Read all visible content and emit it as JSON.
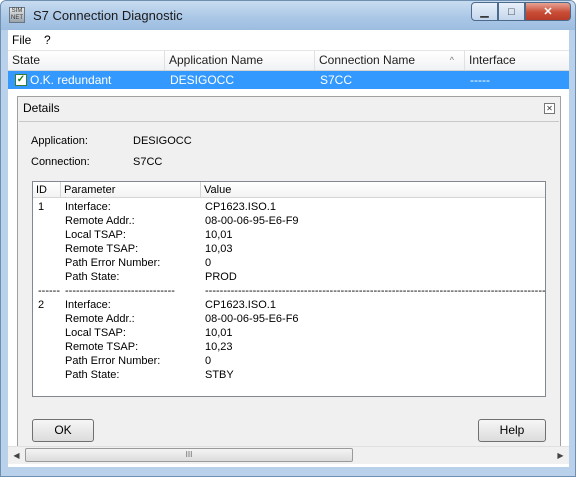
{
  "window": {
    "title": "S7 Connection Diagnostic",
    "icon_text": "SIM NET"
  },
  "menu": [
    "File",
    "?"
  ],
  "list": {
    "columns": [
      "State",
      "Application Name",
      "Connection Name",
      "Interface"
    ],
    "rows": [
      {
        "state": "O.K. redundant",
        "application": "DESIGOCC",
        "connection": "S7CC",
        "interface": "-----"
      }
    ]
  },
  "details": {
    "title": "Details",
    "application_label": "Application:",
    "application_value": "DESIGOCC",
    "connection_label": "Connection:",
    "connection_value": "S7CC",
    "columns": [
      "ID",
      "Parameter",
      "Value"
    ],
    "rows": [
      {
        "id": "1",
        "param": "Interface:",
        "value": "CP1623.ISO.1"
      },
      {
        "id": "",
        "param": "Remote Addr.:",
        "value": "08-00-06-95-E6-F9"
      },
      {
        "id": "",
        "param": "Local TSAP:",
        "value": "10,01"
      },
      {
        "id": "",
        "param": "Remote TSAP:",
        "value": "10,03"
      },
      {
        "id": "",
        "param": "Path Error Number:",
        "value": "0"
      },
      {
        "id": "",
        "param": "Path State:",
        "value": "PROD"
      },
      {
        "id": "------",
        "param": "------------------------------",
        "value": "--------------------------------------------------------------------------------------------------"
      },
      {
        "id": "2",
        "param": "Interface:",
        "value": "CP1623.ISO.1"
      },
      {
        "id": "",
        "param": "Remote Addr.:",
        "value": "08-00-06-95-E6-F6"
      },
      {
        "id": "",
        "param": "Local TSAP:",
        "value": "10,01"
      },
      {
        "id": "",
        "param": "Remote TSAP:",
        "value": "10,23"
      },
      {
        "id": "",
        "param": "Path Error Number:",
        "value": "0"
      },
      {
        "id": "",
        "param": "Path State:",
        "value": "STBY"
      }
    ],
    "ok_label": "OK",
    "help_label": "Help"
  },
  "scrollbar": {
    "thumb_grip": "III"
  }
}
